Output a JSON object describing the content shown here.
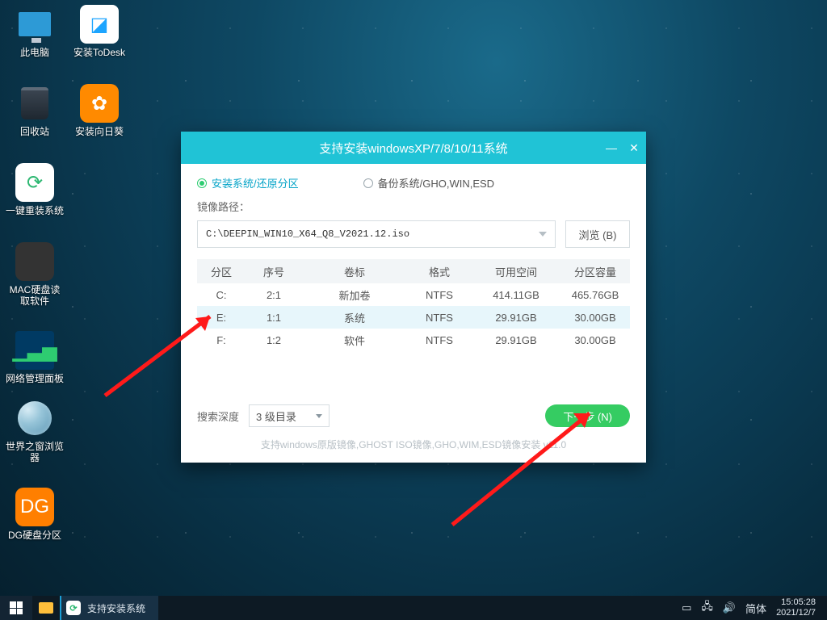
{
  "desktop": {
    "icons": [
      {
        "id": "mypc",
        "label": "此电脑"
      },
      {
        "id": "todesk",
        "label": "安装ToDesk"
      },
      {
        "id": "bin",
        "label": "回收站"
      },
      {
        "id": "sun",
        "label": "安装向日葵"
      },
      {
        "id": "rein",
        "label": "一键重装系统"
      },
      {
        "id": "mac",
        "label": "MAC硬盘读取软件"
      },
      {
        "id": "net",
        "label": "网络管理面板"
      },
      {
        "id": "brw",
        "label": "世界之窗浏览器"
      },
      {
        "id": "dg",
        "label": "DG硬盘分区"
      }
    ]
  },
  "installer": {
    "title": "支持安装windowsXP/7/8/10/11系统",
    "mode_install": "安装系统/还原分区",
    "mode_backup": "备份系统/GHO,WIN,ESD",
    "path_label": "镜像路径：",
    "path_value": "C:\\DEEPIN_WIN10_X64_Q8_V2021.12.iso",
    "browse": "浏览 (B)",
    "columns": {
      "part": "分区",
      "index": "序号",
      "label": "卷标",
      "fs": "格式",
      "free": "可用空间",
      "cap": "分区容量"
    },
    "rows": [
      {
        "part": "C:",
        "index": "2:1",
        "label": "新加卷",
        "fs": "NTFS",
        "free": "414.11GB",
        "cap": "465.76GB",
        "sel": false
      },
      {
        "part": "E:",
        "index": "1:1",
        "label": "系统",
        "fs": "NTFS",
        "free": "29.91GB",
        "cap": "30.00GB",
        "sel": true
      },
      {
        "part": "F:",
        "index": "1:2",
        "label": "软件",
        "fs": "NTFS",
        "free": "29.91GB",
        "cap": "30.00GB",
        "sel": false
      }
    ],
    "depth_label": "搜索深度",
    "depth_value": "3 级目录",
    "next": "下一步 (N)",
    "footer_note": "支持windows原版镜像,GHOST ISO镜像,GHO,WIM,ESD镜像安装 v11.0"
  },
  "taskbar": {
    "task_label": "支持安装系统",
    "ime": "简体",
    "time": "15:05:28",
    "date": "2021/12/7"
  }
}
